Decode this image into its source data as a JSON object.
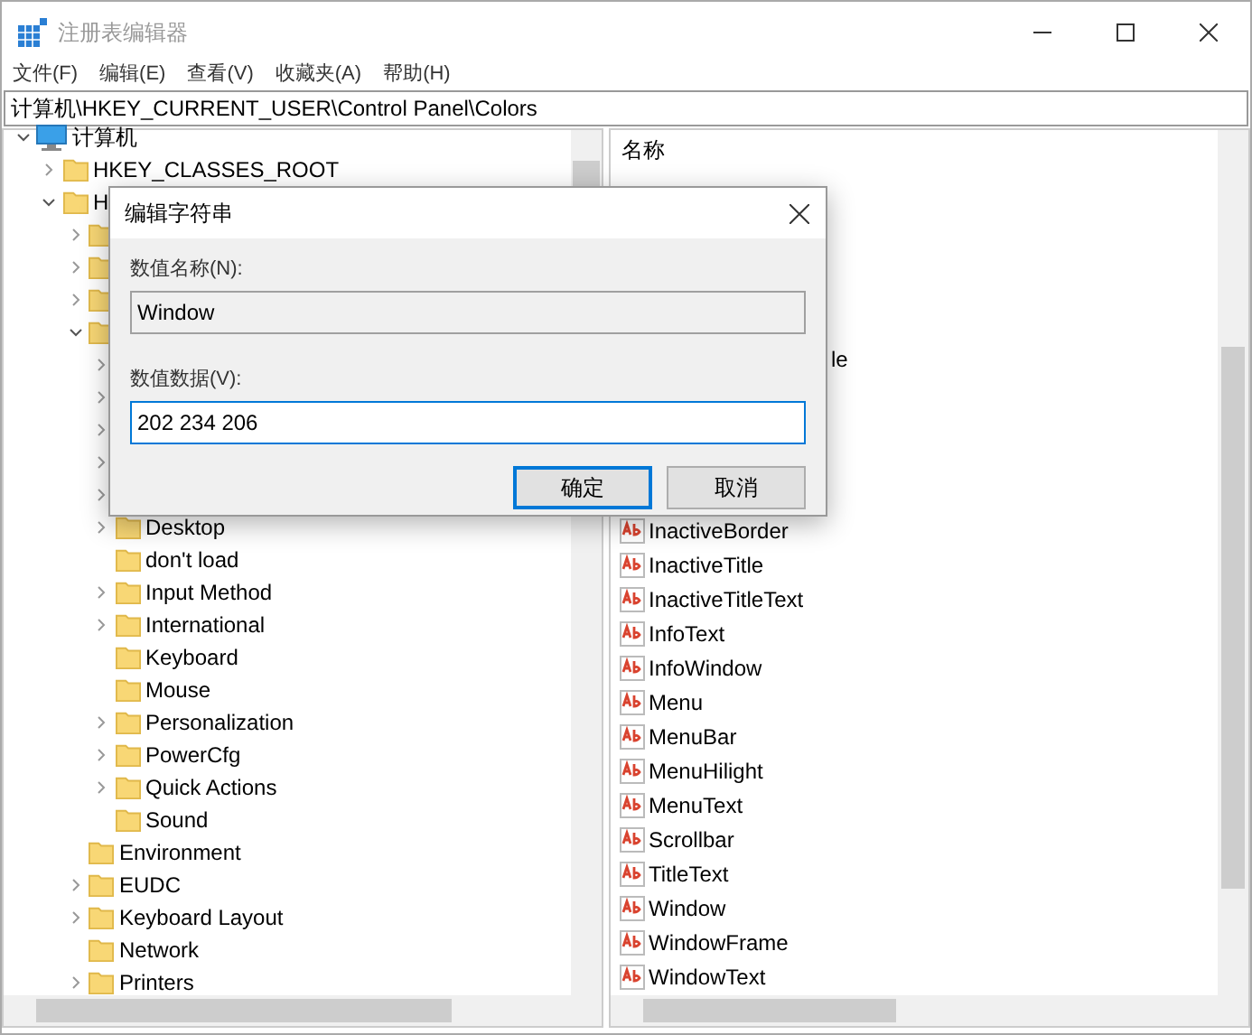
{
  "window": {
    "title": "注册表编辑器"
  },
  "menu": [
    "文件(F)",
    "编辑(E)",
    "查看(V)",
    "收藏夹(A)",
    "帮助(H)"
  ],
  "address": "计算机\\HKEY_CURRENT_USER\\Control Panel\\Colors",
  "tree": [
    {
      "label": "计算机",
      "kind": "computer",
      "expanded": true,
      "children": [
        {
          "label": "HKEY_CLASSES_ROOT",
          "expanded": false
        },
        {
          "label": "H",
          "expanded": true,
          "children": [
            {
              "expanded": false
            },
            {
              "expanded": false
            },
            {
              "expanded": false
            },
            {
              "expanded": true,
              "children": [
                {
                  "expanded": false
                },
                {
                  "expanded": false
                },
                {
                  "expanded": false
                },
                {
                  "expanded": false
                },
                {
                  "expanded": false
                },
                {
                  "label": "Desktop",
                  "expanded": false
                },
                {
                  "label": "don't load"
                },
                {
                  "label": "Input Method",
                  "expanded": false
                },
                {
                  "label": "International",
                  "expanded": false
                },
                {
                  "label": "Keyboard"
                },
                {
                  "label": "Mouse"
                },
                {
                  "label": "Personalization",
                  "expanded": false
                },
                {
                  "label": "PowerCfg",
                  "expanded": false
                },
                {
                  "label": "Quick Actions",
                  "expanded": false
                },
                {
                  "label": "Sound"
                }
              ]
            },
            {
              "label": "Environment"
            },
            {
              "label": "EUDC",
              "expanded": false
            },
            {
              "label": "Keyboard Layout",
              "expanded": false
            },
            {
              "label": "Network"
            },
            {
              "label": "Printers",
              "expanded": false
            }
          ]
        }
      ]
    }
  ],
  "values": {
    "header": "名称",
    "items": [
      {
        "name": "le",
        "kind": "cut"
      },
      {
        "name": "InactiveBorder",
        "kind": "string"
      },
      {
        "name": "InactiveTitle",
        "kind": "string"
      },
      {
        "name": "InactiveTitleText",
        "kind": "string"
      },
      {
        "name": "InfoText",
        "kind": "string"
      },
      {
        "name": "InfoWindow",
        "kind": "string"
      },
      {
        "name": "Menu",
        "kind": "string"
      },
      {
        "name": "MenuBar",
        "kind": "string"
      },
      {
        "name": "MenuHilight",
        "kind": "string"
      },
      {
        "name": "MenuText",
        "kind": "string"
      },
      {
        "name": "Scrollbar",
        "kind": "string"
      },
      {
        "name": "TitleText",
        "kind": "string"
      },
      {
        "name": "Window",
        "kind": "string"
      },
      {
        "name": "WindowFrame",
        "kind": "string"
      },
      {
        "name": "WindowText",
        "kind": "string"
      }
    ]
  },
  "dialog": {
    "title": "编辑字符串",
    "fields": [
      {
        "label": "数值名称(N):",
        "value": "Window",
        "disabled": true
      },
      {
        "label": "数值数据(V):",
        "value": "202 234 206",
        "disabled": false
      }
    ],
    "buttons": [
      {
        "label": "确定",
        "default": true
      },
      {
        "label": "取消",
        "default": false
      }
    ]
  }
}
